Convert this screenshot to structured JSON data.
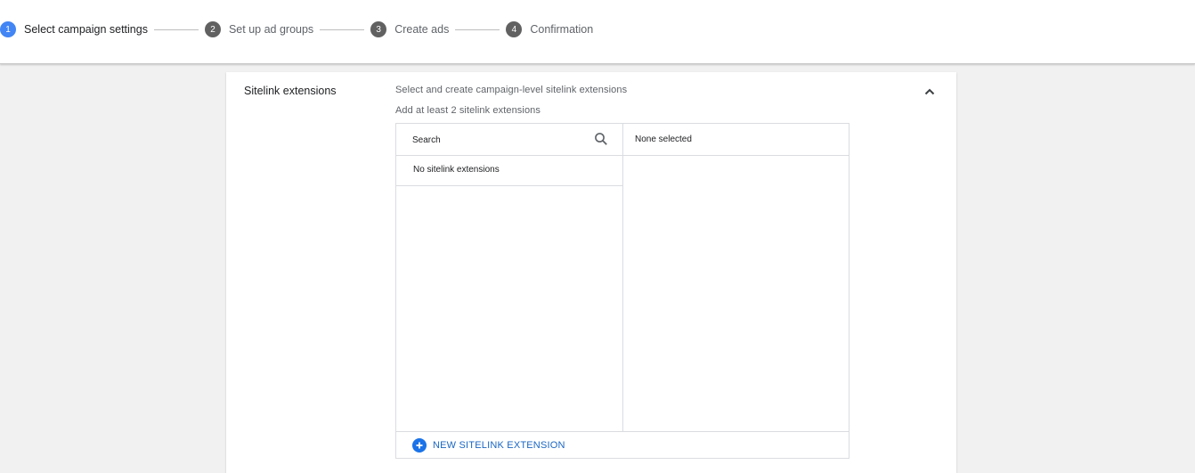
{
  "stepper": {
    "steps": [
      {
        "number": "1",
        "label": "Select campaign settings",
        "active": true
      },
      {
        "number": "2",
        "label": "Set up ad groups",
        "active": false
      },
      {
        "number": "3",
        "label": "Create ads",
        "active": false
      },
      {
        "number": "4",
        "label": "Confirmation",
        "active": false
      }
    ],
    "active_color": "#4285f4",
    "inactive_color": "#616161"
  },
  "section": {
    "title": "Sitelink extensions",
    "description": "Select and create campaign-level sitelink extensions",
    "hint": "Add at least 2 sitelink extensions",
    "collapse_icon": "chevron-up-icon"
  },
  "picker": {
    "search": {
      "placeholder": "Search",
      "value": "",
      "icon": "search-icon"
    },
    "available_empty_text": "No sitelink extensions",
    "selected_header": "None selected",
    "new_button": {
      "label": "NEW SITELINK EXTENSION",
      "icon": "plus-circle-icon",
      "color": "#1a73e8"
    }
  }
}
